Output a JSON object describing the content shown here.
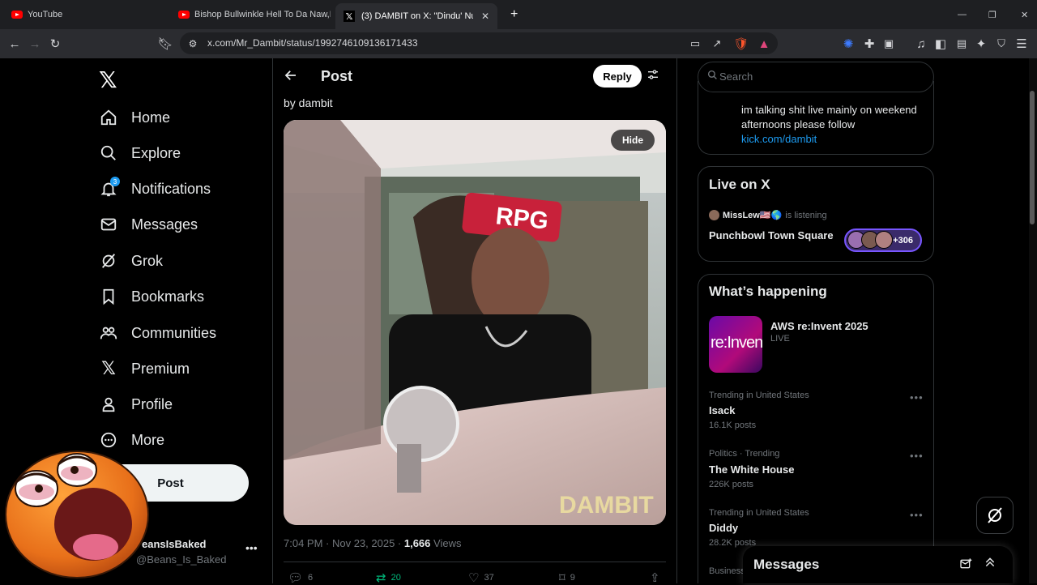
{
  "browser": {
    "tabs": [
      {
        "title": "YouTube"
      },
      {
        "title": "Bishop Bullwinkle Hell To Da Naw,Na"
      },
      {
        "title": "(3) DAMBIT on X: \"Dindu' Nu"
      }
    ],
    "url": "x.com/Mr_Dambit/status/1992746109136171433"
  },
  "nav": {
    "items": [
      {
        "label": "Home"
      },
      {
        "label": "Explore"
      },
      {
        "label": "Notifications"
      },
      {
        "label": "Messages"
      },
      {
        "label": "Grok"
      },
      {
        "label": "Bookmarks"
      },
      {
        "label": "Communities"
      },
      {
        "label": "Premium"
      },
      {
        "label": "Profile"
      },
      {
        "label": "More"
      }
    ],
    "notifications_badge": "3",
    "post_button": "Post",
    "account": {
      "name": "eansIsBaked",
      "handle": "@Beans_Is_Baked"
    }
  },
  "post": {
    "header": "Post",
    "reply_button": "Reply",
    "byline": "by dambit",
    "hide_button": "Hide",
    "media_overlay_text": "DAMBIT",
    "headband_text": "RPG",
    "time": "7:04 PM · Nov 23, 2025 · ",
    "views": "1,666",
    "views_label": " Views",
    "stats": {
      "replies": "6",
      "reposts": "20",
      "likes": "37",
      "bookmarks": "9"
    }
  },
  "sidebar": {
    "search_placeholder": "Search",
    "bio_text": "im talking shit live mainly on weekend afternoons please follow",
    "bio_link": "kick.com/dambit",
    "live": {
      "title": "Live on X",
      "user": "MissLew🇺🇸🌎",
      "status": "is listening",
      "space": "Punchbowl Town Square",
      "count": "+306"
    },
    "whats_happening": {
      "title": "What’s happening",
      "featured": {
        "title": "AWS re:Invent 2025",
        "status": "LIVE",
        "image_text": "re:Invent"
      },
      "trends": [
        {
          "category": "Trending in United States",
          "name": "Isack",
          "count": "16.1K posts"
        },
        {
          "category": "Politics · Trending",
          "name": "The White House",
          "count": "226K posts"
        },
        {
          "category": "Trending in United States",
          "name": "Diddy",
          "count": "28.2K posts"
        },
        {
          "category": "Business",
          "name": "",
          "count": ""
        }
      ]
    }
  },
  "messages_drawer": {
    "title": "Messages"
  },
  "colors": {
    "accent": "#1d9bf0",
    "background": "#000000",
    "border": "#2f3336",
    "repost": "#00ba7c"
  }
}
